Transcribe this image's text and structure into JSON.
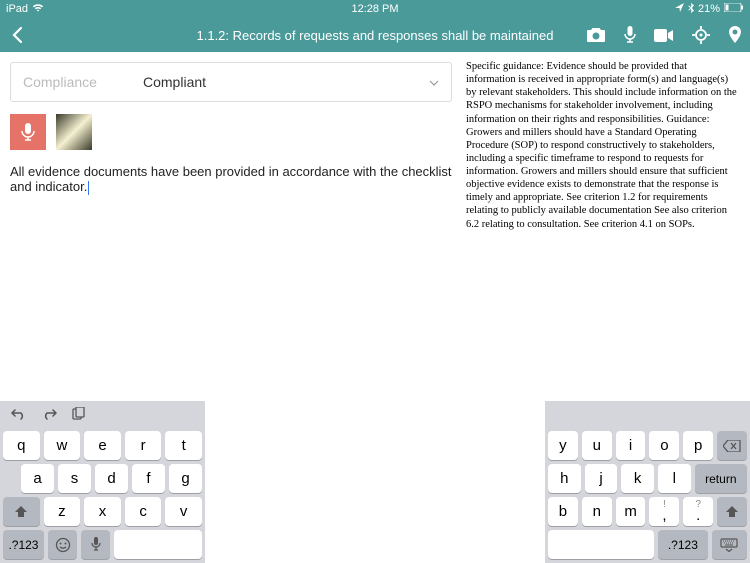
{
  "status": {
    "device": "iPad",
    "time": "12:28 PM",
    "battery": "21%"
  },
  "header": {
    "title": "1.1.2: Records of requests and responses shall be maintained"
  },
  "compliance": {
    "label": "Compliance",
    "value": "Compliant"
  },
  "note": "All evidence documents have been provided in accordance with the checklist and indicator.",
  "guidance": "Specific guidance: Evidence should be provided that information is received in appropriate form(s) and language(s) by relevant stakeholders. This should include information on the RSPO mechanisms for stakeholder involvement, including information on their rights and responsibilities. Guidance: Growers and millers should have a Standard Operating Procedure (SOP) to respond constructively to stakeholders, including a specific timeframe to respond to requests for information. Growers and millers should ensure that sufficient objective evidence exists to demonstrate that the response is timely and appropriate. See criterion 1.2 for requirements relating to publicly available documentation See also criterion 6.2 relating to consultation. See criterion 4.1 on SOPs.",
  "keys": {
    "l1": [
      "q",
      "w",
      "e",
      "r",
      "t"
    ],
    "r1": [
      "y",
      "u",
      "i",
      "o",
      "p"
    ],
    "l2": [
      "a",
      "s",
      "d",
      "f",
      "g"
    ],
    "r2": [
      "h",
      "j",
      "k",
      "l"
    ],
    "l3": [
      "z",
      "x",
      "c",
      "v"
    ],
    "r3": [
      "b",
      "n",
      "m",
      "!",
      ","
    ],
    "r3b": [
      "?",
      "."
    ],
    "numMode": ".?123",
    "returnLabel": "return"
  }
}
